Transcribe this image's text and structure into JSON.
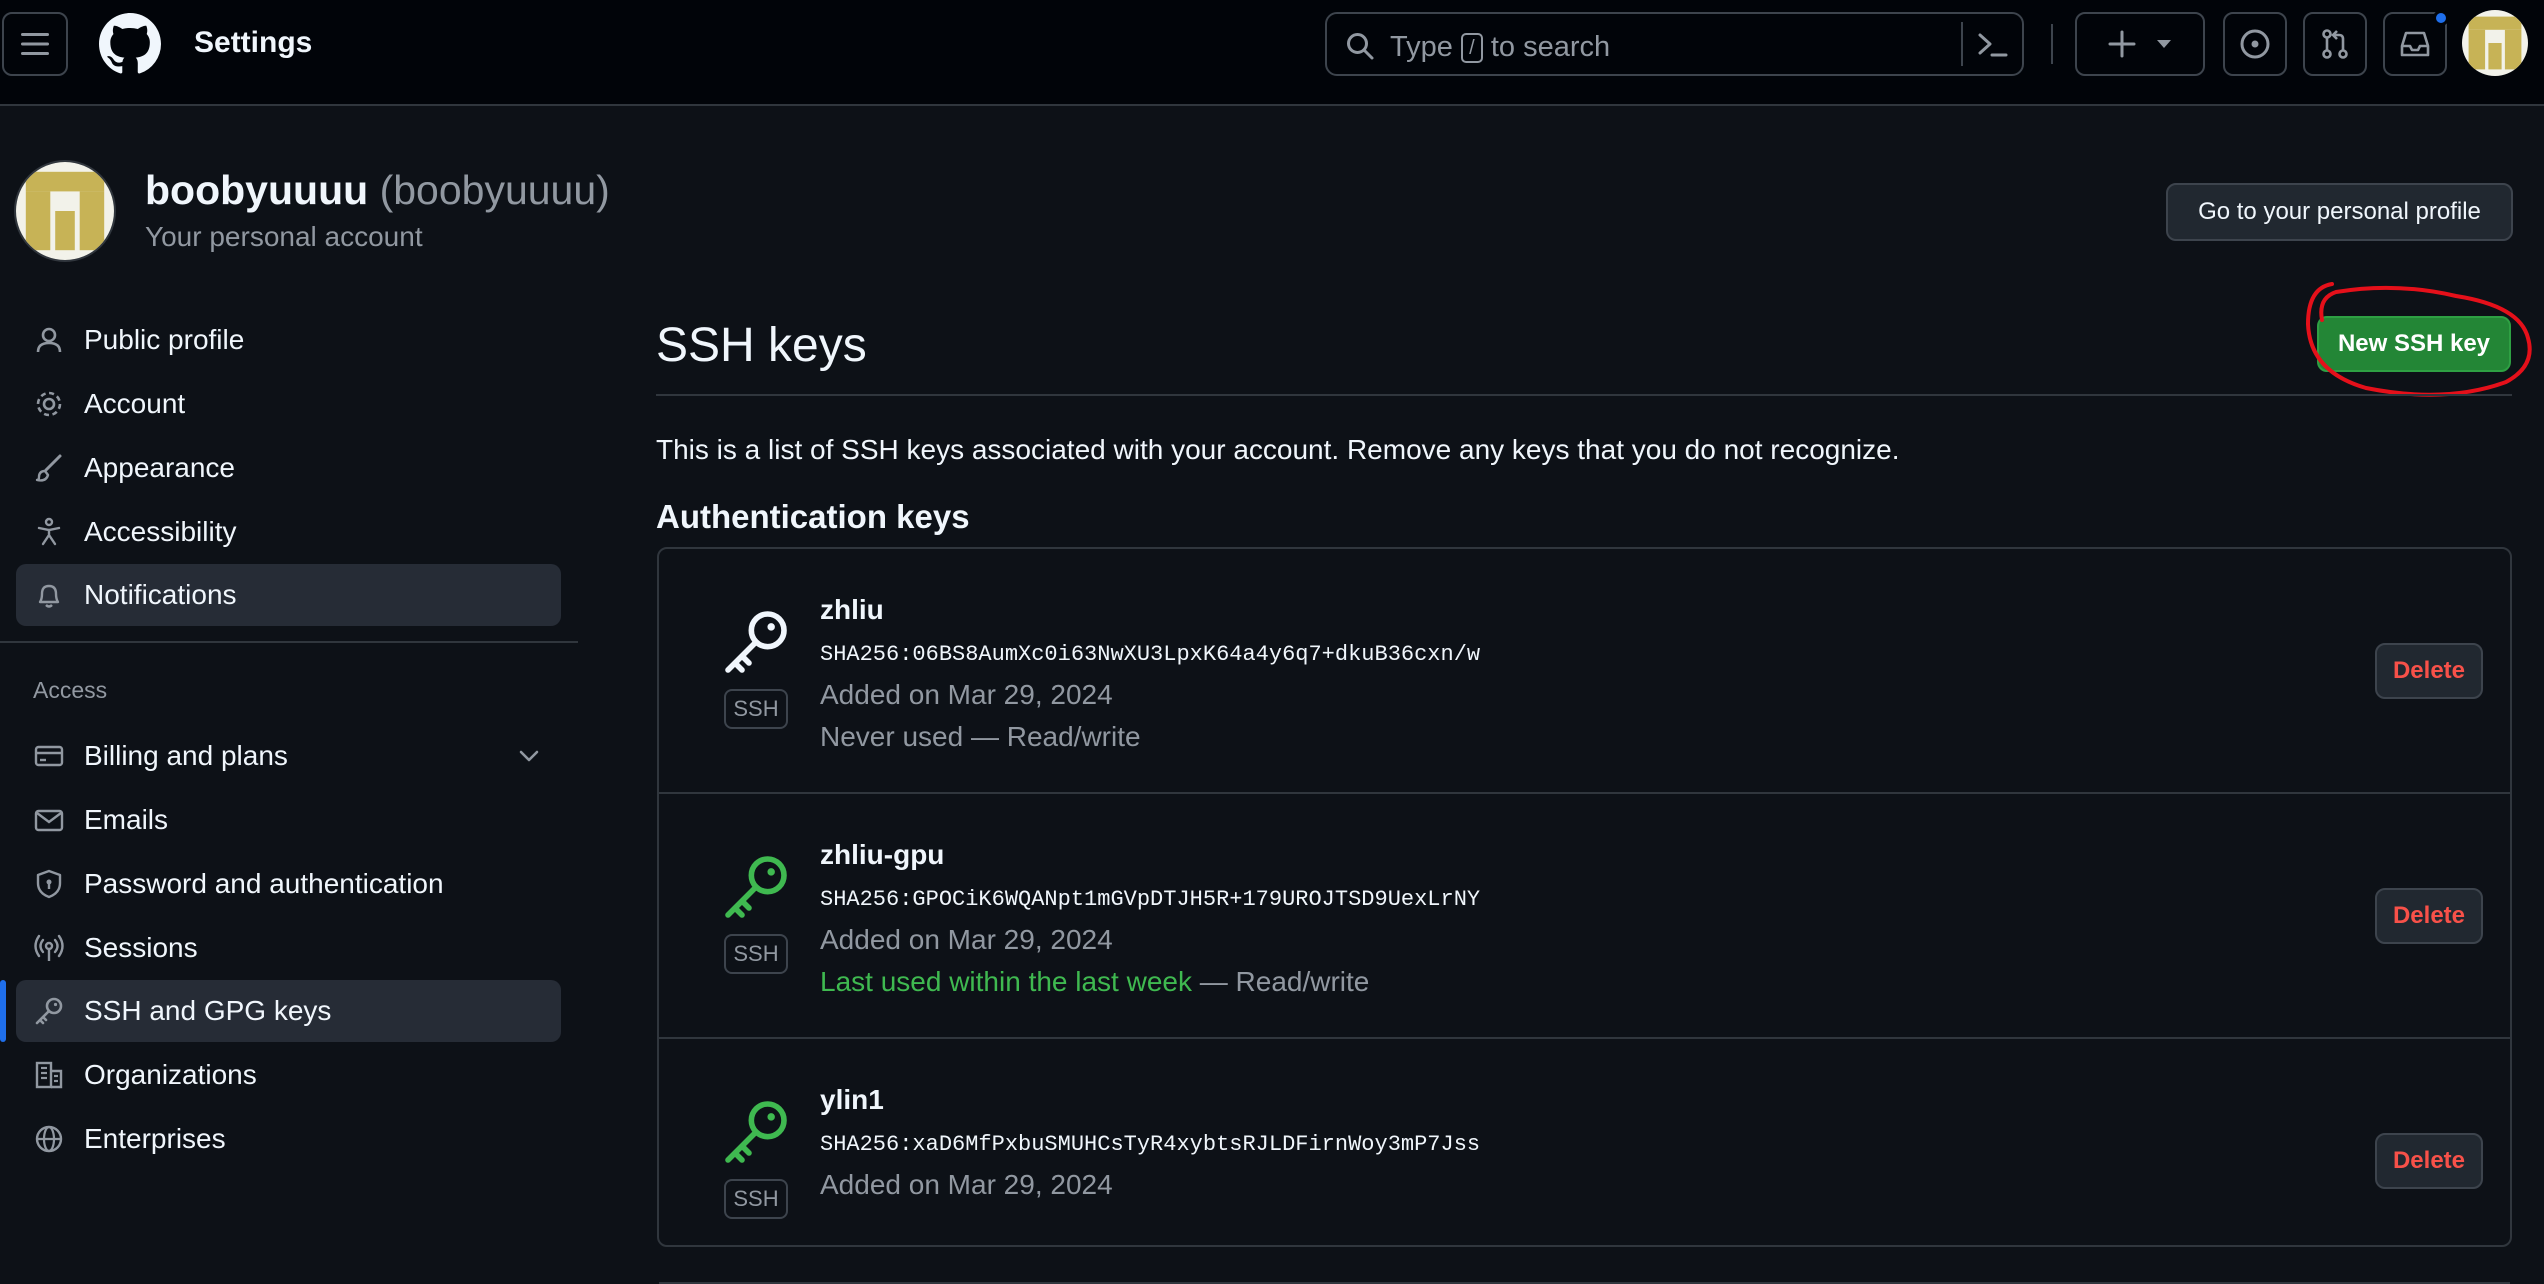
{
  "header": {
    "title": "Settings",
    "search": {
      "prefix": "Type",
      "key": "/",
      "suffix": "to search"
    },
    "icons": [
      "menu-icon",
      "github-logo",
      "search-icon",
      "command-palette-icon",
      "plus-icon",
      "chevron-down-icon",
      "issues-icon",
      "pull-request-icon",
      "inbox-icon"
    ]
  },
  "account": {
    "name": "boobyuuuu",
    "login": "(boobyuuuu)",
    "subtitle": "Your personal account",
    "profile_button": "Go to your personal profile"
  },
  "sidebar": {
    "items": [
      {
        "label": "Public profile",
        "icon": "person-icon"
      },
      {
        "label": "Account",
        "icon": "gear-icon"
      },
      {
        "label": "Appearance",
        "icon": "paintbrush-icon"
      },
      {
        "label": "Accessibility",
        "icon": "accessibility-icon"
      },
      {
        "label": "Notifications",
        "icon": "bell-icon"
      }
    ],
    "access_heading": "Access",
    "access_items": [
      {
        "label": "Billing and plans",
        "icon": "credit-card-icon"
      },
      {
        "label": "Emails",
        "icon": "mail-icon"
      },
      {
        "label": "Password and authentication",
        "icon": "shield-lock-icon"
      },
      {
        "label": "Sessions",
        "icon": "broadcast-icon"
      },
      {
        "label": "SSH and GPG keys",
        "icon": "key-icon"
      },
      {
        "label": "Organizations",
        "icon": "organization-icon"
      },
      {
        "label": "Enterprises",
        "icon": "globe-icon"
      }
    ]
  },
  "main": {
    "title": "SSH keys",
    "new_key_button": "New SSH key",
    "intro": "This is a list of SSH keys associated with your account. Remove any keys that you do not recognize.",
    "auth_heading": "Authentication keys",
    "keys": [
      {
        "name": "zhliu",
        "type": "SSH",
        "fingerprint": "SHA256:06BS8AumXc0i63NwXU3LpxK64a4y6q7+dkuB36cxn/w",
        "added": "Added on Mar 29, 2024",
        "usage": "Never used",
        "access": "— Read/write",
        "delete": "Delete",
        "icon_color": "#f0f6fc"
      },
      {
        "name": "zhliu-gpu",
        "type": "SSH",
        "fingerprint": "SHA256:GPOCiK6WQANpt1mGVpDTJH5R+179UROJTSD9UexLrNY",
        "added": "Added on Mar 29, 2024",
        "usage": "Last used within the last week",
        "access": "— Read/write",
        "delete": "Delete",
        "icon_color": "#3fb950"
      },
      {
        "name": "ylin1",
        "type": "SSH",
        "fingerprint": "SHA256:xaD6MfPxbuSMUHCsTyR4xybtsRJLDFirnWoy3mP7Jss",
        "added": "Added on Mar 29, 2024",
        "usage": "",
        "access": "",
        "delete": "Delete",
        "icon_color": "#3fb950"
      }
    ]
  },
  "colors": {
    "accent_blue": "#1f6feb",
    "primary_green": "#238636",
    "danger_red": "#f85149",
    "annotation_red": "#e5101a"
  }
}
